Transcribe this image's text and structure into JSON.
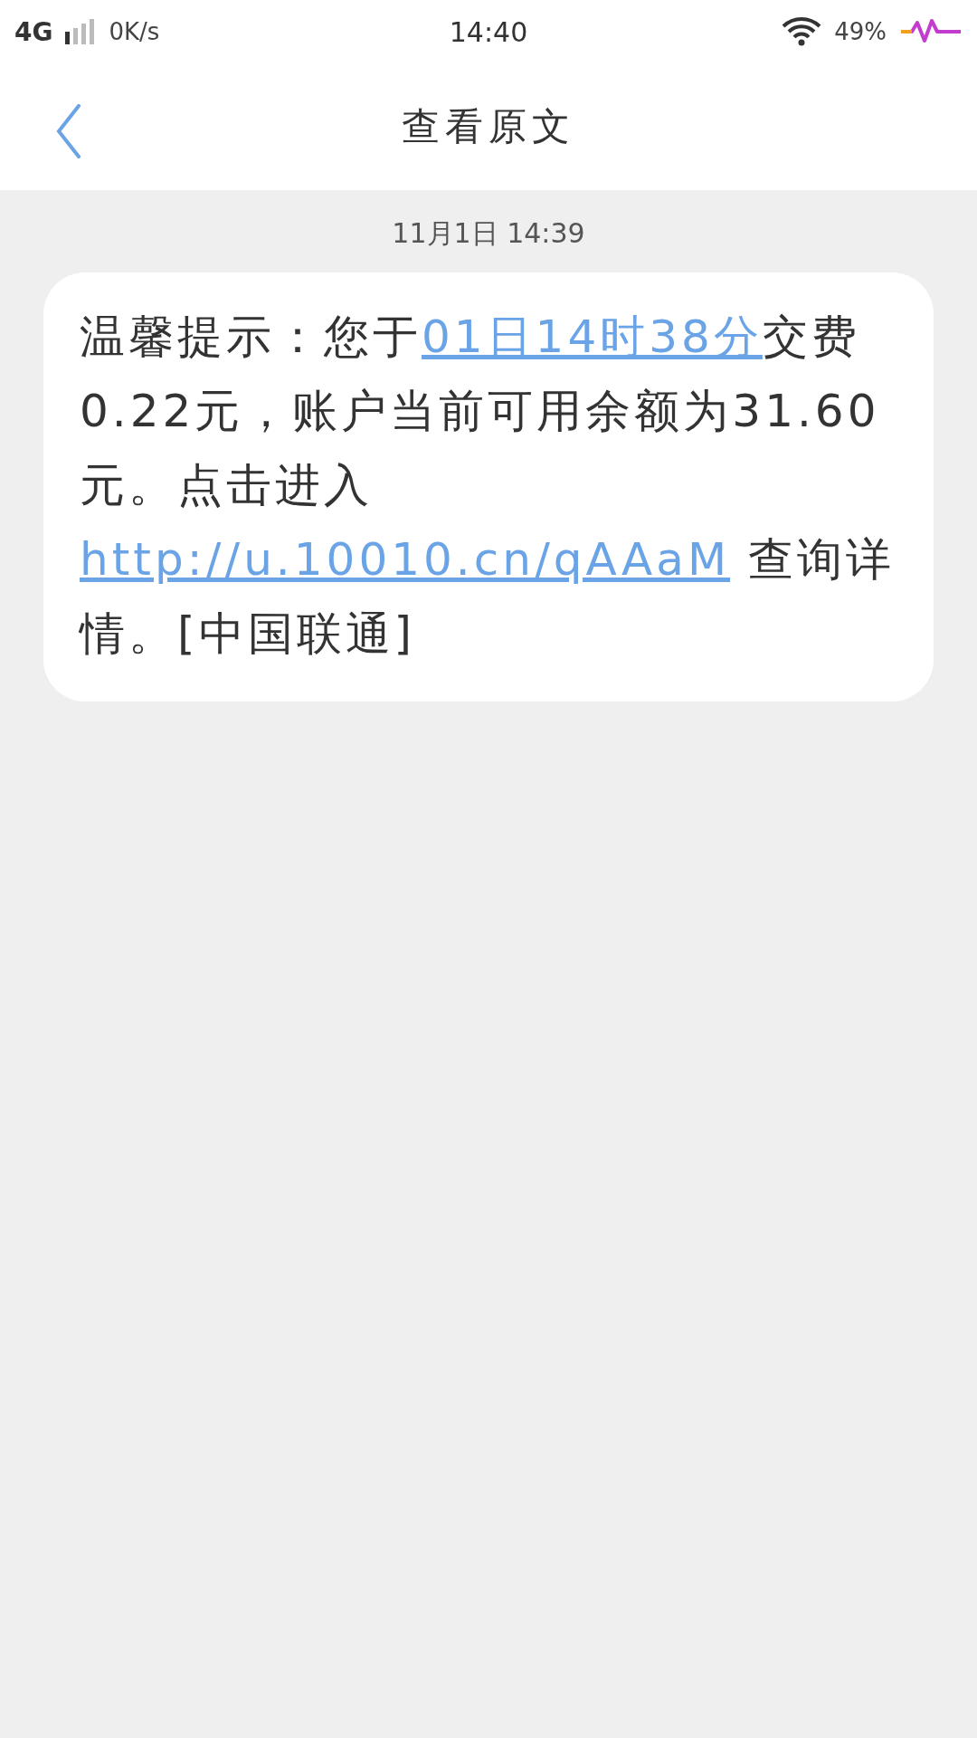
{
  "status_bar": {
    "network": "4G",
    "speed": "0K/s",
    "time": "14:40",
    "battery": "49%"
  },
  "header": {
    "title": "查看原文"
  },
  "thread": {
    "timestamp": "11月1日 14:39",
    "message": [
      {
        "kind": "text",
        "text": "温馨提示：您于"
      },
      {
        "kind": "link",
        "text": "01日14时38分"
      },
      {
        "kind": "text",
        "text": "交费0.22元，账户当前可用余额为31.60元。点击进入"
      },
      {
        "kind": "link",
        "text": "http://u.10010.cn/qAAaM"
      },
      {
        "kind": "text",
        "text": " 查询详情。[中国联通]"
      }
    ]
  }
}
